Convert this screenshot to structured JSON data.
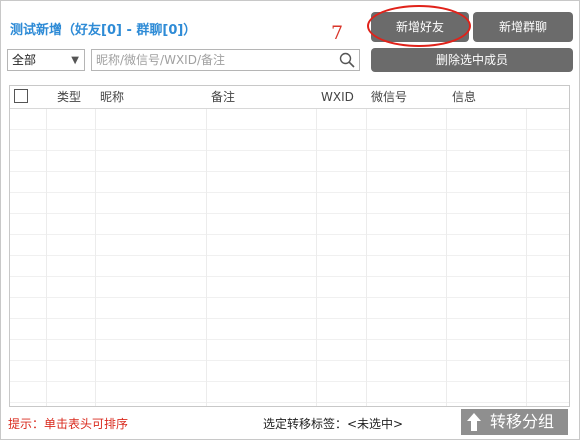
{
  "header": {
    "title": "测试新增（好友[0] - 群聊[0]）",
    "annotation": "7"
  },
  "buttons": {
    "add_friend": "新增好友",
    "add_group": "新增群聊",
    "delete_selected": "删除选中成员"
  },
  "filter": {
    "selected": "全部"
  },
  "search": {
    "placeholder": "昵称/微信号/WXID/备注"
  },
  "table": {
    "columns": [
      "类型",
      "昵称",
      "备注",
      "WXID",
      "微信号",
      "信息"
    ],
    "rows": []
  },
  "footer": {
    "hint": "提示：单击表头可排序",
    "status": "选定转移标签：<未选中>",
    "move_button": "转移分组"
  },
  "icons": {
    "filter_dropdown": "chevron-down-icon",
    "search": "search-icon",
    "move": "arrow-up-icon"
  },
  "colors": {
    "title": "#2e8bd6",
    "button_bg": "#6b6b6b",
    "hint": "#d92a1e",
    "annotation": "#d9352a",
    "move_button_bg": "#8f8f8f"
  }
}
